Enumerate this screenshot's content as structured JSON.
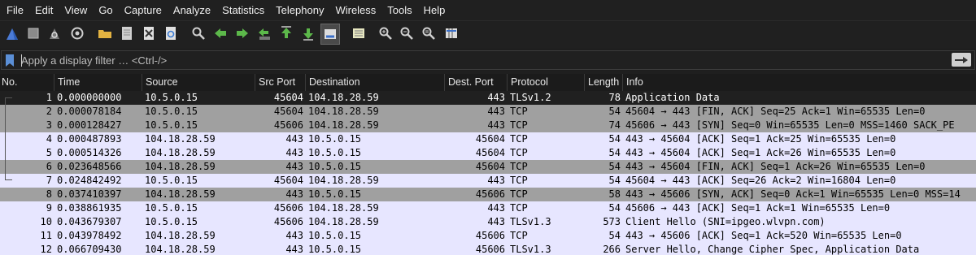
{
  "menu": [
    "File",
    "Edit",
    "View",
    "Go",
    "Capture",
    "Analyze",
    "Statistics",
    "Telephony",
    "Wireless",
    "Tools",
    "Help"
  ],
  "filter": {
    "placeholder": "Apply a display filter … <Ctrl-/>"
  },
  "columns": [
    "No.",
    "Time",
    "Source",
    "Src Port",
    "Destination",
    "Dest. Port",
    "Protocol",
    "Length",
    "Info"
  ],
  "rows": [
    {
      "no": "1",
      "time": "0.000000000",
      "src": "10.5.0.15",
      "sport": "45604",
      "dst": "104.18.28.59",
      "dport": "443",
      "proto": "TLSv1.2",
      "len": "78",
      "info": "Application Data",
      "style": "sel"
    },
    {
      "no": "2",
      "time": "0.000078184",
      "src": "10.5.0.15",
      "sport": "45604",
      "dst": "104.18.28.59",
      "dport": "443",
      "proto": "TCP",
      "len": "54",
      "info": "45604 → 443 [FIN, ACK] Seq=25 Ack=1 Win=65535 Len=0",
      "style": "tcpflag"
    },
    {
      "no": "3",
      "time": "0.000128427",
      "src": "10.5.0.15",
      "sport": "45606",
      "dst": "104.18.28.59",
      "dport": "443",
      "proto": "TCP",
      "len": "74",
      "info": "45606 → 443 [SYN] Seq=0 Win=65535 Len=0 MSS=1460 SACK_PE",
      "style": "tcpflag"
    },
    {
      "no": "4",
      "time": "0.000487893",
      "src": "104.18.28.59",
      "sport": "443",
      "dst": "10.5.0.15",
      "dport": "45604",
      "proto": "TCP",
      "len": "54",
      "info": "443 → 45604 [ACK] Seq=1 Ack=25 Win=65535 Len=0",
      "style": "light"
    },
    {
      "no": "5",
      "time": "0.000514326",
      "src": "104.18.28.59",
      "sport": "443",
      "dst": "10.5.0.15",
      "dport": "45604",
      "proto": "TCP",
      "len": "54",
      "info": "443 → 45604 [ACK] Seq=1 Ack=26 Win=65535 Len=0",
      "style": "light"
    },
    {
      "no": "6",
      "time": "0.023648566",
      "src": "104.18.28.59",
      "sport": "443",
      "dst": "10.5.0.15",
      "dport": "45604",
      "proto": "TCP",
      "len": "54",
      "info": "443 → 45604 [FIN, ACK] Seq=1 Ack=26 Win=65535 Len=0",
      "style": "tcpflag"
    },
    {
      "no": "7",
      "time": "0.024842492",
      "src": "10.5.0.15",
      "sport": "45604",
      "dst": "104.18.28.59",
      "dport": "443",
      "proto": "TCP",
      "len": "54",
      "info": "45604 → 443 [ACK] Seq=26 Ack=2 Win=16804 Len=0",
      "style": "light"
    },
    {
      "no": "8",
      "time": "0.037410397",
      "src": "104.18.28.59",
      "sport": "443",
      "dst": "10.5.0.15",
      "dport": "45606",
      "proto": "TCP",
      "len": "58",
      "info": "443 → 45606 [SYN, ACK] Seq=0 Ack=1 Win=65535 Len=0 MSS=14",
      "style": "tcpflag"
    },
    {
      "no": "9",
      "time": "0.038861935",
      "src": "10.5.0.15",
      "sport": "45606",
      "dst": "104.18.28.59",
      "dport": "443",
      "proto": "TCP",
      "len": "54",
      "info": "45606 → 443 [ACK] Seq=1 Ack=1 Win=65535 Len=0",
      "style": "light"
    },
    {
      "no": "10",
      "time": "0.043679307",
      "src": "10.5.0.15",
      "sport": "45606",
      "dst": "104.18.28.59",
      "dport": "443",
      "proto": "TLSv1.3",
      "len": "573",
      "info": "Client Hello (SNI=ipgeo.wlvpn.com)",
      "style": "tls"
    },
    {
      "no": "11",
      "time": "0.043978492",
      "src": "104.18.28.59",
      "sport": "443",
      "dst": "10.5.0.15",
      "dport": "45606",
      "proto": "TCP",
      "len": "54",
      "info": "443 → 45606 [ACK] Seq=1 Ack=520 Win=65535 Len=0",
      "style": "light"
    },
    {
      "no": "12",
      "time": "0.066709430",
      "src": "104.18.28.59",
      "sport": "443",
      "dst": "10.5.0.15",
      "dport": "45606",
      "proto": "TLSv1.3",
      "len": "266",
      "info": "Server Hello, Change Cipher Spec, Application Data",
      "style": "tls"
    }
  ],
  "toolbar": [
    {
      "icon": "shark-fin-start-icon"
    },
    {
      "icon": "stop-capture-icon"
    },
    {
      "icon": "restart-capture-icon"
    },
    {
      "icon": "capture-options-icon"
    },
    {
      "icon": "open-file-icon"
    },
    {
      "icon": "save-file-icon"
    },
    {
      "icon": "close-file-icon"
    },
    {
      "icon": "reload-file-icon"
    },
    {
      "icon": "find-packet-icon"
    },
    {
      "icon": "go-back-icon"
    },
    {
      "icon": "go-forward-icon"
    },
    {
      "icon": "go-to-packet-icon"
    },
    {
      "icon": "go-first-icon"
    },
    {
      "icon": "go-last-icon"
    },
    {
      "icon": "autoscroll-icon"
    },
    {
      "icon": "colorize-icon"
    },
    {
      "icon": "zoom-in-icon"
    },
    {
      "icon": "zoom-out-icon"
    },
    {
      "icon": "normal-size-icon"
    },
    {
      "icon": "resize-columns-icon"
    }
  ]
}
